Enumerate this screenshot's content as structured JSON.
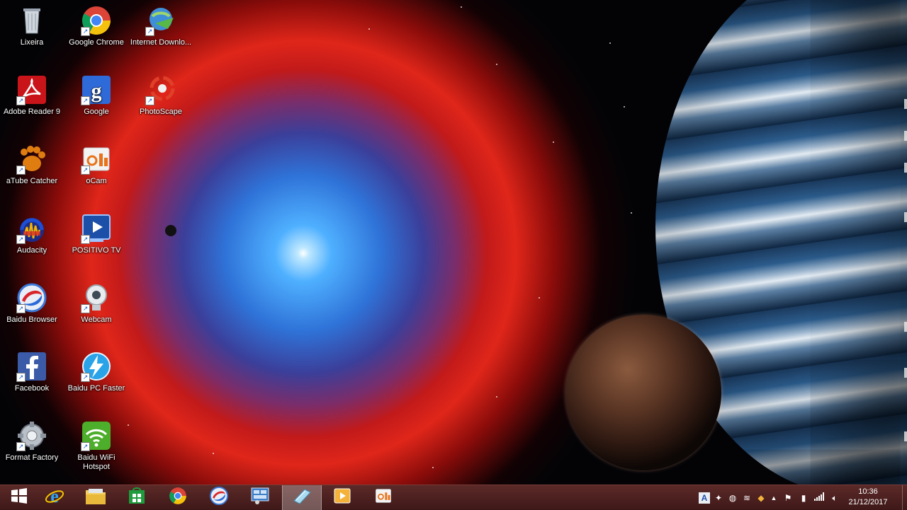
{
  "desktop": {
    "icons": [
      {
        "label": "Lixeira"
      },
      {
        "label": "Google Chrome"
      },
      {
        "label": "Internet Downlo..."
      },
      {
        "label": "Adobe Reader 9"
      },
      {
        "label": "Google"
      },
      {
        "label": "PhotoScape"
      },
      {
        "label": "aTube Catcher"
      },
      {
        "label": "oCam"
      },
      {
        "label": "Audacity"
      },
      {
        "label": "POSITIVO TV"
      },
      {
        "label": "Baidu Browser"
      },
      {
        "label": "Webcam"
      },
      {
        "label": "Facebook"
      },
      {
        "label": "Baidu PC Faster"
      },
      {
        "label": "Format Factory"
      },
      {
        "label": "Baidu WiFi Hotspot"
      }
    ]
  },
  "taskbar": {
    "clock": {
      "time": "10:36",
      "date": "21/12/2017"
    },
    "tray_up_arrow": "▲",
    "colors": {
      "background": "#4a1f1e",
      "active": "#ffffff"
    }
  }
}
